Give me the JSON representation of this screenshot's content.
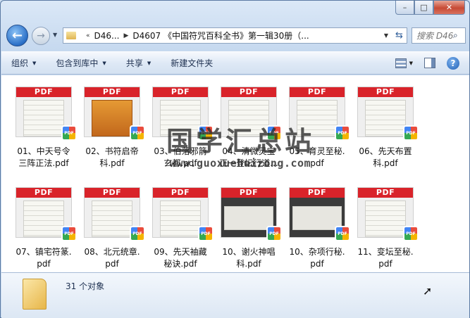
{
  "window": {
    "minimize_glyph": "–",
    "maximize_glyph": "□",
    "close_glyph": "✕"
  },
  "nav": {
    "back_glyph": "←",
    "forward_glyph": "→",
    "crumbs": [
      "D46...",
      "D4607 《中国符咒百科全书》第一辑30册（..."
    ],
    "search_placeholder": "搜索 D46..."
  },
  "toolbar": {
    "organize": "组织",
    "include_in_library": "包含到库中",
    "share": "共享",
    "new_folder": "新建文件夹"
  },
  "files": {
    "pdf_band": "PDF",
    "items": [
      {
        "line1": "01、中天号令",
        "line2": "三阵正法.pdf"
      },
      {
        "line1": "02、书符启帝",
        "line2": "科.pdf"
      },
      {
        "line1": "03、伯落邪箭",
        "line2": "玄都.pdf"
      },
      {
        "line1": "04、清微灵宝",
        "line2": "正一登坛行道..."
      },
      {
        "line1": "05、育灵至秘.",
        "line2": "pdf"
      },
      {
        "line1": "06、先天布置",
        "line2": "科.pdf"
      },
      {
        "line1": "07、镇宅符篆.",
        "line2": "pdf"
      },
      {
        "line1": "08、北元统章.",
        "line2": "pdf"
      },
      {
        "line1": "09、先天袖藏",
        "line2": "秘诀.pdf"
      },
      {
        "line1": "10、谢火神唱",
        "line2": "科.pdf"
      },
      {
        "line1": "10、杂项行秘.",
        "line2": "pdf"
      },
      {
        "line1": "11、变坛至秘.",
        "line2": "pdf"
      }
    ]
  },
  "watermark": {
    "cn": "国学汇总站",
    "url": "www.guoxuehuizong.com"
  },
  "status": {
    "count": "31 个对象"
  },
  "colors": {
    "pdf_red": "#d9232a",
    "accent_blue": "#2a6fc7"
  }
}
